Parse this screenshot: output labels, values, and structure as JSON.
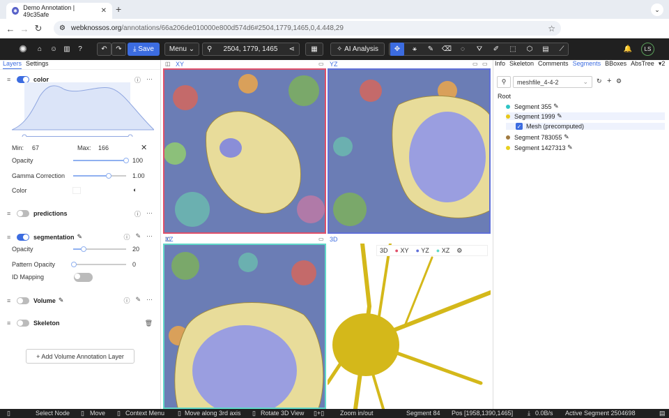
{
  "browser": {
    "tab_title": "Demo Annotation | 49c35afe",
    "url_host": "webknossos.org",
    "url_path": "/annotations/66a206de010000e800d574d6#2504,1779,1465,0,4.448,29"
  },
  "toolbar": {
    "save_label": "Save",
    "menu_label": "Menu",
    "position": "2504, 1779, 1465",
    "ai_label": "AI Analysis",
    "user_initials": "LS"
  },
  "left_tabs": [
    "Layers",
    "Settings"
  ],
  "color_layer": {
    "name": "color",
    "min_label": "Min:",
    "min_value": "67",
    "max_label": "Max:",
    "max_value": "166",
    "opacity_label": "Opacity",
    "opacity_value": "100",
    "gamma_label": "Gamma Correction",
    "gamma_value": "1.00",
    "color_label": "Color"
  },
  "predictions_layer": {
    "name": "predictions"
  },
  "segmentation_layer": {
    "name": "segmentation",
    "opacity_label": "Opacity",
    "opacity_value": "20",
    "pattern_label": "Pattern Opacity",
    "pattern_value": "0",
    "idmap_label": "ID Mapping"
  },
  "volume_layer": {
    "name": "Volume"
  },
  "skeleton_layer": {
    "name": "Skeleton"
  },
  "add_layer_label": "+ Add Volume Annotation Layer",
  "viewports": {
    "xy": "XY",
    "yz": "YZ",
    "xz": "XZ",
    "td": "3D",
    "td_buttons": [
      "3D",
      "XY",
      "YZ",
      "XZ"
    ]
  },
  "right_tabs": [
    "Info",
    "Skeleton",
    "Comments",
    "Segments",
    "BBoxes",
    "AbsTree",
    "2"
  ],
  "segments": {
    "meshfile": "meshfile_4-4-2",
    "root": "Root",
    "items": [
      {
        "label": "Segment 355",
        "color": "#2ec4c4"
      },
      {
        "label": "Segment 1999",
        "color": "#e8c81a"
      },
      {
        "label": "Mesh (precomputed)",
        "color": ""
      },
      {
        "label": "Segment 783055",
        "color": "#a07a40"
      },
      {
        "label": "Segment 1427313",
        "color": "#e8d020"
      }
    ]
  },
  "status": {
    "select_node": "Select Node",
    "move": "Move",
    "context": "Context Menu",
    "move3rd": "Move along 3rd axis",
    "rotate": "Rotate 3D View",
    "zoom": "Zoom in/out",
    "segment": "Segment 84",
    "pos": "Pos [1958,1390,1465]",
    "bandwidth": "0.0B/s",
    "active_segment": "Active Segment 2504698"
  }
}
